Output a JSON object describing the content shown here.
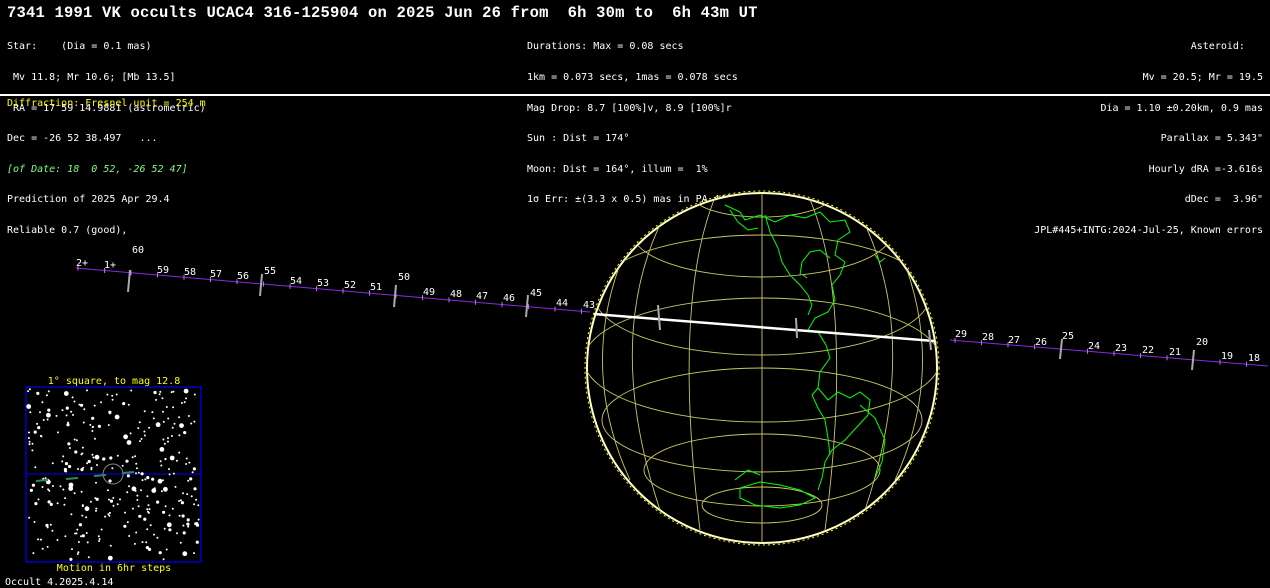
{
  "header": {
    "title": "7341 1991 VK occults UCAC4 316-125904 on 2025 Jun 26 from  6h 30m to  6h 43m UT"
  },
  "star_info": [
    "Star:    (Dia = 0.1 mas)",
    " Mv 11.8; Mr 10.6; [Mb 13.5]",
    " RA = 17 59 14.9881 (astrometric)",
    "Dec = -26 52 38.497   ...",
    "[of Date: 18  0 52, -26 52 47]",
    "Prediction of 2025 Apr 29.4",
    "Reliable 0.7 (good),"
  ],
  "event_info": [
    "Durations: Max = 0.08 secs",
    "1km = 0.073 secs, 1mas = 0.078 secs",
    "Mag Drop: 8.7 [100%]v, 8.9 [100%]r",
    "Sun : Dist = 174°",
    "Moon: Dist = 164°, illum =  1%",
    "1σ Err: ±(3.3 x 0.5) mas in PA 44°"
  ],
  "asteroid_info": [
    "Asteroid:   ",
    "Mv = 20.5; Mr = 19.5",
    "Dia = 1.10 ±0.20km, 0.9 mas",
    "Parallax = 5.343\"",
    "Hourly dRA =-3.616s",
    "dDec =  3.96\"",
    "JPL#445+INTG:2024-Jul-25, Known errors"
  ],
  "diffraction": "Diffraction: Fresnel unit = 254 m",
  "track_labels_left": [
    "2+",
    "1+",
    "60",
    "59",
    "58",
    "57",
    "56",
    "55",
    "54",
    "53",
    "52",
    "51",
    "50",
    "49",
    "48",
    "47",
    "46",
    "45",
    "44",
    "43"
  ],
  "track_labels_right": [
    "29",
    "28",
    "27",
    "26",
    "25",
    "24",
    "23",
    "22",
    "21",
    "20",
    "19",
    "18"
  ],
  "inset": {
    "title": "1° square, to mag 12.8",
    "caption": "Motion in 6hr steps"
  },
  "version": "Occult 4.2025.4.14",
  "colors": {
    "background": "#000000",
    "header_rule": "#ffffff",
    "diffraction_text": "#ffff00",
    "of_date_text": "#7dff7d",
    "track_line": "#8a2be2",
    "path_line": "#ffffff",
    "globe_grid": "#c8c864",
    "coastline": "#00ff00",
    "globe_limb": "#ffffc8",
    "inset_frame": "#0000ff"
  }
}
